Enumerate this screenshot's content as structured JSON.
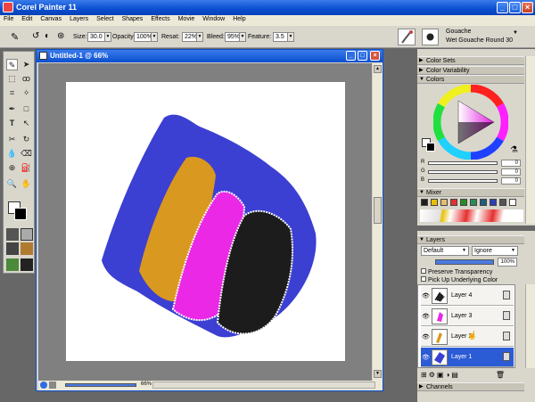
{
  "app": {
    "title": "Corel Painter 11"
  },
  "menu": [
    "File",
    "Edit",
    "Canvas",
    "Layers",
    "Select",
    "Shapes",
    "Effects",
    "Movie",
    "Window",
    "Help"
  ],
  "property_bar": {
    "size_label": "Size:",
    "size_value": "30.0",
    "opacity_label": "Opacity:",
    "opacity_value": "100%",
    "resat_label": "Resat:",
    "resat_value": "22%",
    "bleed_label": "Bleed:",
    "bleed_value": "95%",
    "feature_label": "Feature:",
    "feature_value": "3.5"
  },
  "brush": {
    "category": "Gouache",
    "variant": "Wet Gouache Round 30"
  },
  "document": {
    "title": "Untitled-1 @ 66%",
    "zoom": "66%"
  },
  "panels": {
    "color_sets": "Color Sets",
    "color_variability": "Color Variability",
    "colors": "Colors",
    "rgb": [
      {
        "label": "R",
        "value": "0"
      },
      {
        "label": "G",
        "value": "0"
      },
      {
        "label": "B",
        "value": "0"
      }
    ],
    "mixer": "Mixer",
    "layers": "Layers",
    "composite_method": "Default",
    "depth_method": "Ignore",
    "opacity": "100%",
    "preserve_transparency": "Preserve Transparency",
    "pick_up_underlying": "Pick Up Underlying Color",
    "layer_list": [
      {
        "name": "Layer 4",
        "selected": false
      },
      {
        "name": "Layer 3",
        "selected": false
      },
      {
        "name": "Layer 2",
        "selected": false
      },
      {
        "name": "Layer 1",
        "selected": true
      }
    ],
    "channels": "Channels"
  },
  "colors": {
    "stroke_blue": "#3b3fd2",
    "stroke_ochre": "#d9981f",
    "stroke_magenta": "#ea28e6",
    "stroke_black": "#1c1c1c",
    "accent": "#0a4fd0"
  },
  "mixer_swatches": [
    "#1e1e1e",
    "#e8c000",
    "#e0c070",
    "#e53030",
    "#2a8a2a",
    "#2e8a5a",
    "#1f5f7a",
    "#2f3fb0",
    "#555555",
    "#ffffff"
  ],
  "icons": [
    "brush-icon",
    "selection-icon",
    "eyedropper-icon",
    "paint-bucket-icon",
    "text-icon",
    "zoom-icon",
    "hand-icon",
    "eye-icon",
    "lock-icon",
    "trash-icon"
  ]
}
